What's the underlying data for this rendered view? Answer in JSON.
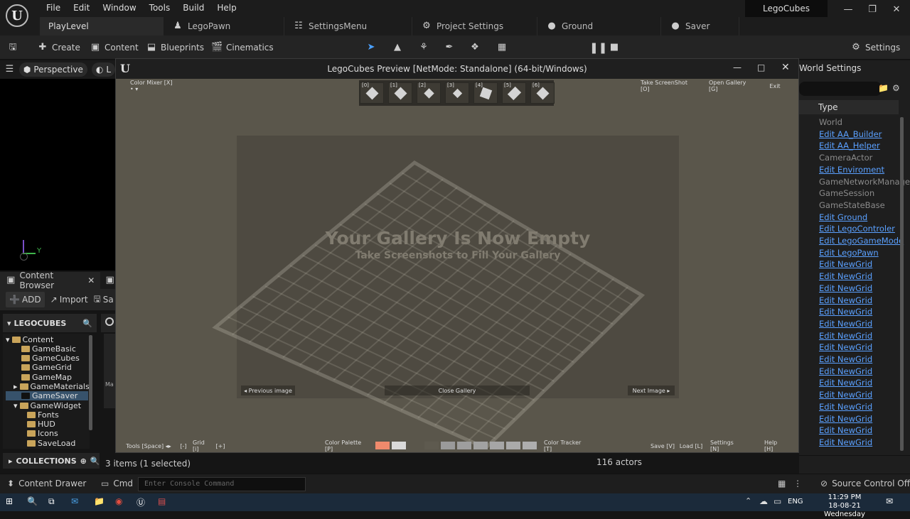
{
  "menu": [
    "File",
    "Edit",
    "Window",
    "Tools",
    "Build",
    "Help"
  ],
  "project_name": "LegoCubes",
  "tabs": [
    {
      "label": "PlayLevel",
      "icon": ""
    },
    {
      "label": "LegoPawn",
      "icon": "pawn-icon"
    },
    {
      "label": "SettingsMenu",
      "icon": "widget-icon"
    },
    {
      "label": "Project Settings",
      "icon": "settings-icon"
    },
    {
      "label": "Ground",
      "icon": "material-icon"
    },
    {
      "label": "Saver",
      "icon": "material-icon"
    }
  ],
  "toolbar": {
    "create": "Create",
    "content": "Content",
    "blueprints": "Blueprints",
    "cinematics": "Cinematics",
    "settings": "Settings"
  },
  "viewport": {
    "perspective": "Perspective",
    "lit": "L",
    "axis_y": "Y"
  },
  "content_browser": {
    "tab": "Content Browser",
    "add": "ADD",
    "import": "Import",
    "save": "Sa",
    "root": "LEGOCUBES",
    "tree": [
      "Content",
      "GameBasic",
      "GameCubes",
      "GameGrid",
      "GameMap",
      "GameMaterials",
      "GameSaver",
      "GameWidget",
      "Fonts",
      "HUD",
      "Icons",
      "SaveLoad"
    ],
    "collections": "COLLECTIONS",
    "items_status": "3 items (1 selected)",
    "side_label": "Ma"
  },
  "outliner": {
    "header": "World Settings",
    "type_header": "Type",
    "actors_count": "116 actors",
    "rows": [
      {
        "text": "World",
        "link": false
      },
      {
        "text": "Edit AA_Builder",
        "link": true
      },
      {
        "text": "Edit AA_Helper",
        "link": true
      },
      {
        "text": "CameraActor",
        "link": false
      },
      {
        "text": "Edit Enviroment",
        "link": true
      },
      {
        "text": "GameNetworkManage",
        "link": false
      },
      {
        "text": "GameSession",
        "link": false
      },
      {
        "text": "GameStateBase",
        "link": false
      },
      {
        "text": "Edit Ground",
        "link": true
      },
      {
        "text": "Edit LegoControler",
        "link": true
      },
      {
        "text": "Edit LegoGameMode",
        "link": true
      },
      {
        "text": "Edit LegoPawn",
        "link": true
      },
      {
        "text": "Edit NewGrid",
        "link": true
      },
      {
        "text": "Edit NewGrid",
        "link": true
      },
      {
        "text": "Edit NewGrid",
        "link": true
      },
      {
        "text": "Edit NewGrid",
        "link": true
      },
      {
        "text": "Edit NewGrid",
        "link": true
      },
      {
        "text": "Edit NewGrid",
        "link": true
      },
      {
        "text": "Edit NewGrid",
        "link": true
      },
      {
        "text": "Edit NewGrid",
        "link": true
      },
      {
        "text": "Edit NewGrid",
        "link": true
      },
      {
        "text": "Edit NewGrid",
        "link": true
      },
      {
        "text": "Edit NewGrid",
        "link": true
      },
      {
        "text": "Edit NewGrid",
        "link": true
      },
      {
        "text": "Edit NewGrid",
        "link": true
      },
      {
        "text": "Edit NewGrid",
        "link": true
      },
      {
        "text": "Edit NewGrid",
        "link": true
      },
      {
        "text": "Edit NewGrid",
        "link": true
      }
    ]
  },
  "game": {
    "title": "LegoCubes Preview [NetMode: Standalone]  (64-bit/Windows)",
    "color_mixer": "Color Mixer [X]  • ▾",
    "take_screenshot": "Take ScreenShot [O]",
    "open_gallery": "Open Gallery [G]",
    "exit": "Exit",
    "cube_slots": [
      "[0]",
      "[1]",
      "[2]",
      "[3]",
      "[4]",
      "[5]",
      "[6]"
    ],
    "empty_title": "Your Gallery Is Now Empty",
    "empty_sub": "Take Screenshots to Fill Your Gallery",
    "prev_image": "◂ Previous image",
    "close_gallery": "Close Gallery",
    "next_image": "Next Image ▸",
    "tools": "Tools [Space]  ◂▸",
    "grid_minus": "[-]",
    "grid": "Grid [i]",
    "grid_plus": "[+]",
    "color_palette": "Color Palette [P]",
    "color_tracker": "Color Tracker [T]",
    "save": "Save [V]",
    "load": "Load [L]",
    "settings": "Settings [N]",
    "help": "Help [H]",
    "palette": [
      "#f08a6c",
      "#d9d9d9",
      "#5a564b",
      "#5e5a4f",
      "#9a9a9a",
      "#9e9e9e",
      "#a2a2a2",
      "#a6a6a6",
      "#aaaaaa",
      "#aeaeae"
    ]
  },
  "bottom": {
    "content_drawer": "Content Drawer",
    "cmd": "Cmd",
    "console_placeholder": "Enter Console Command",
    "source_control": "Source Control Off"
  },
  "taskbar": {
    "lang": "ENG",
    "time": "11:29 PM",
    "date": "18-08-21 Wednesday"
  }
}
